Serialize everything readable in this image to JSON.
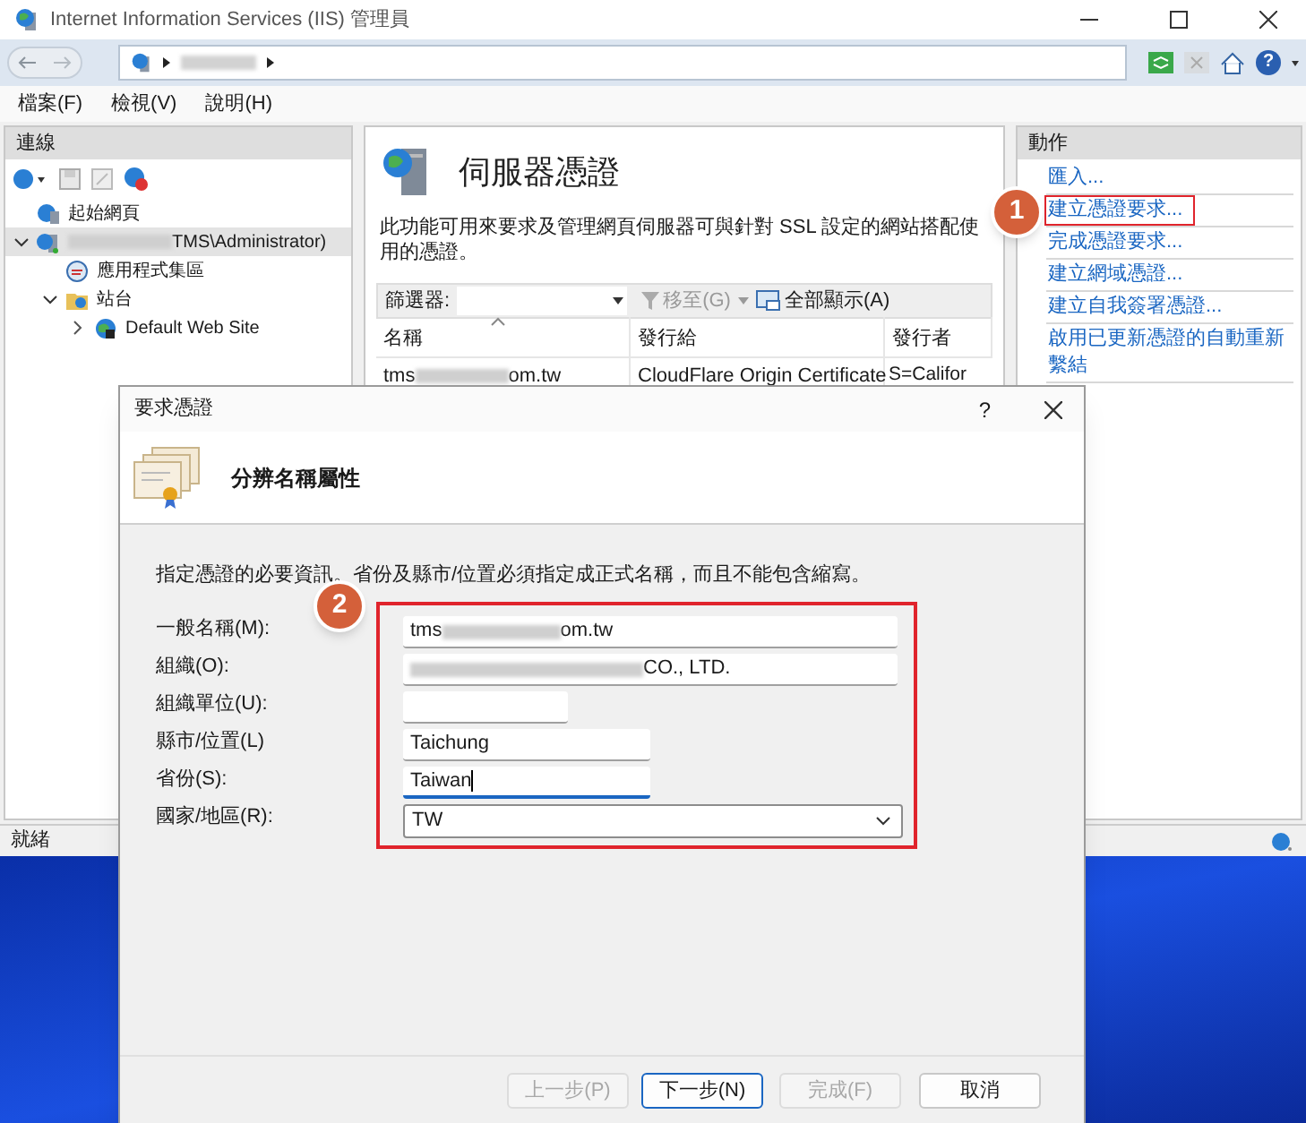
{
  "window": {
    "title": "Internet Information Services (IIS) 管理員"
  },
  "toolbar": {
    "help": "?"
  },
  "menu": [
    {
      "label": "檔案(F)"
    },
    {
      "label": "檢視(V)"
    },
    {
      "label": "說明(H)"
    }
  ],
  "connections": {
    "title": "連線",
    "tree": [
      {
        "kind": "home",
        "parts": [
          {
            "kind": "text",
            "text": "起始網頁"
          }
        ],
        "selected": false
      },
      {
        "kind": "server",
        "parts": [
          {
            "kind": "redacted"
          },
          {
            "kind": "text",
            "text": "TMS\\Administrator)"
          }
        ],
        "selected": true,
        "expanded": true,
        "children": [
          {
            "kind": "pools",
            "parts": [
              {
                "kind": "text",
                "text": "應用程式集區"
              }
            ],
            "selected": false
          },
          {
            "kind": "sites",
            "parts": [
              {
                "kind": "text",
                "text": "站台"
              }
            ],
            "selected": false,
            "expanded": true,
            "children": [
              {
                "kind": "website",
                "parts": [
                  {
                    "kind": "text",
                    "text": "Default Web Site"
                  }
                ],
                "selected": false,
                "expanded": false
              }
            ]
          }
        ]
      }
    ]
  },
  "center": {
    "title": "伺服器憑證",
    "description": "此功能可用來要求及管理網頁伺服器可與針對 SSL 設定的網站搭配使用的憑證。",
    "filter": {
      "label": "篩選器:",
      "go": "移至(G)",
      "show_all": "全部顯示(A)"
    },
    "table": {
      "columns": [
        "名稱",
        "發行給",
        "發行者"
      ],
      "rows": [
        {
          "name": [
            {
              "kind": "text",
              "text": "tms"
            },
            {
              "kind": "redacted"
            },
            {
              "kind": "text",
              "text": "om.tw"
            }
          ],
          "issued_to": "CloudFlare Origin Certificate",
          "issuer": "S=Califor"
        }
      ]
    }
  },
  "actions": {
    "title": "動作",
    "items": [
      {
        "label": "匯入...",
        "outlined": false
      },
      {
        "label": "建立憑證要求...",
        "outlined": true
      },
      {
        "label": "完成憑證要求...",
        "outlined": false
      },
      {
        "label": "建立網域憑證...",
        "outlined": false
      },
      {
        "label": "建立自我簽署憑證...",
        "outlined": false
      },
      {
        "label": "啟用已更新憑證的自動重新繫結",
        "outlined": false
      }
    ]
  },
  "status_bar": {
    "text": "就緒"
  },
  "dialog": {
    "title": "要求憑證",
    "help": "?",
    "heading": "分辨名稱屬性",
    "instruction": "指定憑證的必要資訊。省份及縣市/位置必須指定成正式名稱，而且不能包含縮寫。",
    "outlined": true,
    "fields": [
      {
        "kind": "text",
        "label": "一般名稱(M):",
        "parts": [
          {
            "kind": "text",
            "text": "tms"
          },
          {
            "kind": "redacted"
          },
          {
            "kind": "text",
            "text": "om.tw"
          }
        ],
        "focused": false
      },
      {
        "kind": "text",
        "label": "組織(O):",
        "parts": [
          {
            "kind": "redacted"
          },
          {
            "kind": "text",
            "text": "CO., LTD."
          }
        ],
        "focused": false
      },
      {
        "kind": "text",
        "label": "組織單位(U):",
        "focused": false
      },
      {
        "kind": "text",
        "label": "縣市/位置(L)",
        "parts": [
          {
            "kind": "text",
            "text": "Taichung"
          }
        ],
        "focused": false
      },
      {
        "kind": "text",
        "label": "省份(S):",
        "parts": [
          {
            "kind": "text",
            "text": "Taiwan"
          }
        ],
        "focused": true
      },
      {
        "kind": "select",
        "label": "國家/地區(R):",
        "parts": [
          {
            "kind": "text",
            "text": "TW"
          }
        ]
      }
    ],
    "buttons": [
      {
        "label": "上一步(P)",
        "disabled": true,
        "default": false
      },
      {
        "label": "下一步(N)",
        "disabled": false,
        "default": true
      },
      {
        "label": "完成(F)",
        "disabled": true,
        "default": false
      },
      {
        "label": "取消",
        "disabled": false,
        "default": false
      }
    ]
  },
  "annotations": [
    {
      "label": "1",
      "kind": "action"
    },
    {
      "label": "2",
      "kind": "fields"
    }
  ]
}
